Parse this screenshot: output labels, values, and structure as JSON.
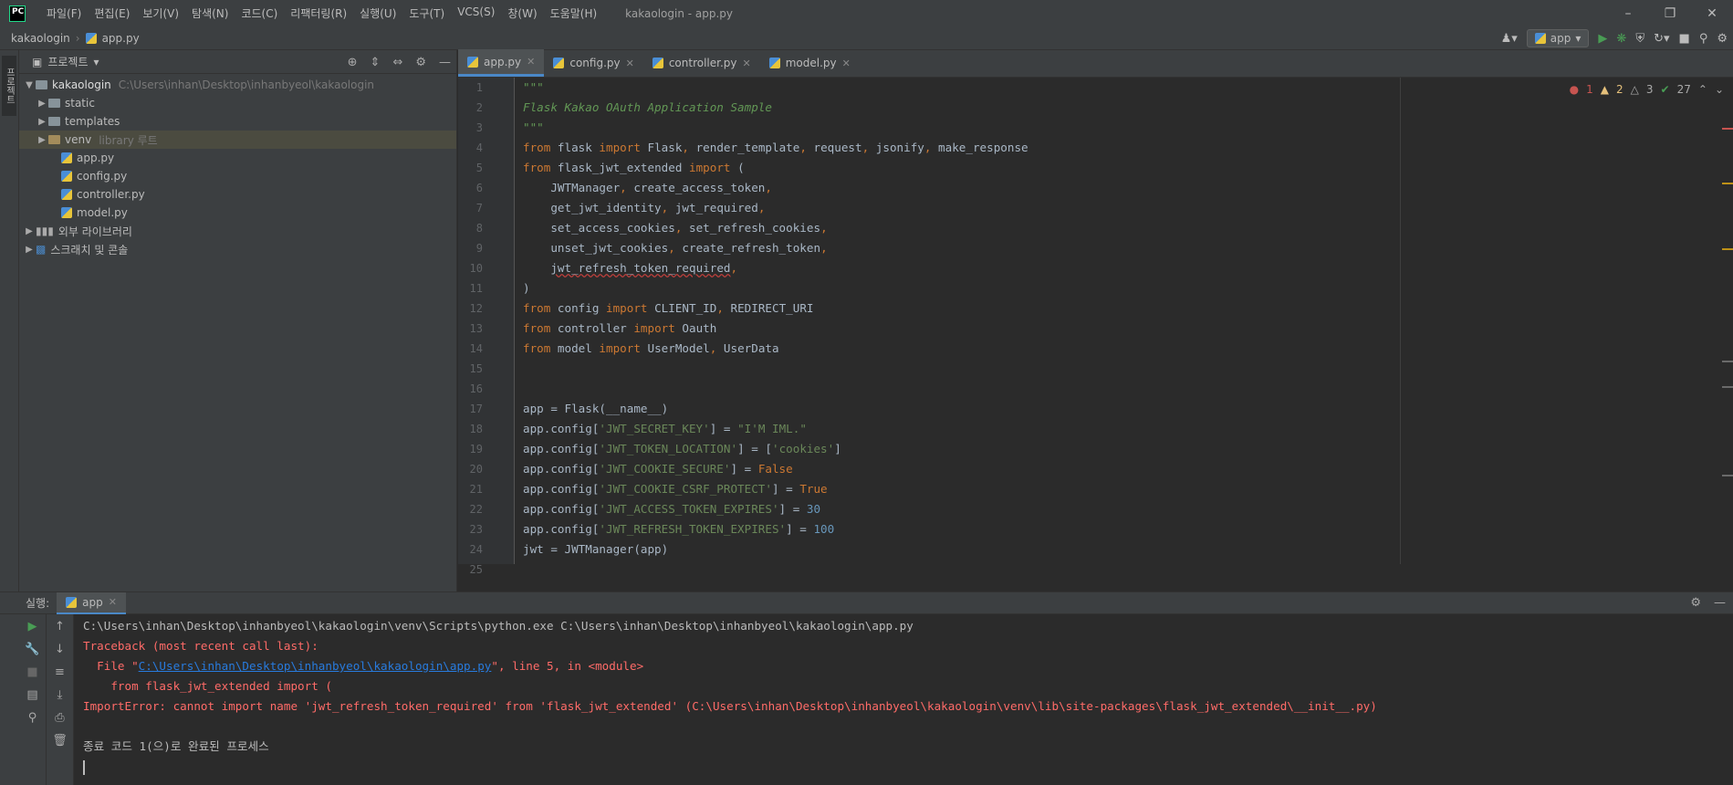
{
  "app": {
    "logo": "PC",
    "window_title": "kakaologin - app.py"
  },
  "menu": [
    "파일(F)",
    "편집(E)",
    "보기(V)",
    "탐색(N)",
    "코드(C)",
    "리팩터링(R)",
    "실행(U)",
    "도구(T)",
    "VCS(S)",
    "창(W)",
    "도움말(H)"
  ],
  "breadcrumb": {
    "project": "kakaologin",
    "file": "app.py"
  },
  "run_config": "app",
  "leftstrip": {
    "project_tab": "프로젝트"
  },
  "project": {
    "header": "프로젝트",
    "root": {
      "name": "kakaologin",
      "path": "C:\\Users\\inhan\\Desktop\\inhanbyeol\\kakaologin"
    },
    "folders": [
      {
        "name": "static",
        "hint": ""
      },
      {
        "name": "templates",
        "hint": ""
      },
      {
        "name": "venv",
        "hint": "library 루트"
      }
    ],
    "files": [
      "app.py",
      "config.py",
      "controller.py",
      "model.py"
    ],
    "extra": [
      "외부 라이브러리",
      "스크래치 및 콘솔"
    ]
  },
  "tabs": [
    {
      "label": "app.py",
      "active": true
    },
    {
      "label": "config.py",
      "active": false
    },
    {
      "label": "controller.py",
      "active": false
    },
    {
      "label": "model.py",
      "active": false
    }
  ],
  "inspection": {
    "errors": "1",
    "warnings": "2",
    "weak": "3",
    "ok": "27"
  },
  "line_numbers": [
    "1",
    "2",
    "3",
    "4",
    "5",
    "6",
    "7",
    "8",
    "9",
    "10",
    "11",
    "12",
    "13",
    "14",
    "15",
    "16",
    "17",
    "18",
    "19",
    "20",
    "21",
    "22",
    "23",
    "24",
    "25"
  ],
  "code_lines": [
    "\"\"\"",
    "Flask Kakao OAuth Application Sample",
    "\"\"\"",
    "from flask import Flask, render_template, request, jsonify, make_response",
    "from flask_jwt_extended import (",
    "    JWTManager, create_access_token,",
    "    get_jwt_identity, jwt_required,",
    "    set_access_cookies, set_refresh_cookies,",
    "    unset_jwt_cookies, create_refresh_token,",
    "    jwt_refresh_token_required,",
    ")",
    "from config import CLIENT_ID, REDIRECT_URI",
    "from controller import Oauth",
    "from model import UserModel, UserData",
    "",
    "",
    "app = Flask(__name__)",
    "app.config['JWT_SECRET_KEY'] = \"I'M IML.\"",
    "app.config['JWT_TOKEN_LOCATION'] = ['cookies']",
    "app.config['JWT_COOKIE_SECURE'] = False",
    "app.config['JWT_COOKIE_CSRF_PROTECT'] = True",
    "app.config['JWT_ACCESS_TOKEN_EXPIRES'] = 30",
    "app.config['JWT_REFRESH_TOKEN_EXPIRES'] = 100",
    "jwt = JWTManager(app)"
  ],
  "run": {
    "label": "실행:",
    "tab": "app",
    "console": {
      "command": "C:\\Users\\inhan\\Desktop\\inhanbyeol\\kakaologin\\venv\\Scripts\\python.exe C:\\Users\\inhan\\Desktop\\inhanbyeol\\kakaologin\\app.py",
      "traceback": "Traceback (most recent call last):",
      "file_prefix": "  File \"",
      "file_link": "C:\\Users\\inhan\\Desktop\\inhanbyeol\\kakaologin\\app.py",
      "file_suffix": "\", line 5, in <module>",
      "code": "    from flask_jwt_extended import (",
      "error": "ImportError: cannot import name 'jwt_refresh_token_required' from 'flask_jwt_extended' (C:\\Users\\inhan\\Desktop\\inhanbyeol\\kakaologin\\venv\\lib\\site-packages\\flask_jwt_extended\\__init__.py)",
      "exit": "종료 코드 1(으)로 완료된 프로세스"
    }
  }
}
